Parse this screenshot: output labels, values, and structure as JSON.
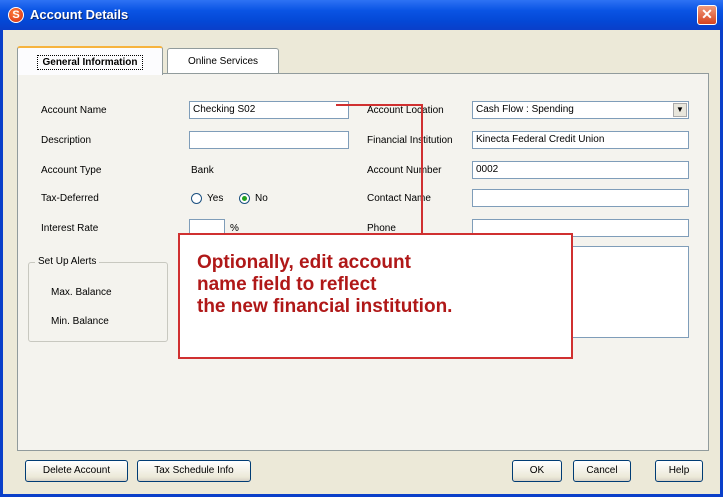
{
  "window": {
    "title": "Account Details",
    "close": "✕",
    "app_icon": "S"
  },
  "tabs": [
    {
      "label": "General Information",
      "active": true
    },
    {
      "label": "Online Services",
      "active": false
    }
  ],
  "form": {
    "account_name_label": "Account Name",
    "account_name_value": "Checking S02",
    "description_label": "Description",
    "description_value": "",
    "account_type_label": "Account Type",
    "account_type_value": "Bank",
    "tax_deferred_label": "Tax-Deferred",
    "tax_yes_label": "Yes",
    "tax_no_label": "No",
    "tax_selected": "No",
    "interest_rate_label": "Interest Rate",
    "interest_rate_unit": "%",
    "account_location_label": "Account Location",
    "account_location_value": "Cash Flow : Spending",
    "financial_institution_label": "Financial Institution",
    "financial_institution_value": "Kinecta Federal Credit  Union",
    "account_number_label": "Account Number",
    "account_number_value": "0002",
    "contact_name_label": "Contact Name",
    "phone_label": "Phone"
  },
  "alerts": {
    "title": "Set Up Alerts",
    "max_label": "Max. Balance",
    "min_label": "Min. Balance"
  },
  "callout": {
    "line1": "Optionally, edit account",
    "line2": "name field to reflect",
    "line3": "the new financial  institution."
  },
  "buttons": {
    "delete": "Delete Account",
    "tax_schedule": "Tax Schedule Info",
    "ok": "OK",
    "cancel": "Cancel",
    "help": "Help"
  },
  "colors": {
    "titlebar": "#0a54e4",
    "callout_border": "#d03030",
    "callout_text": "#b01818"
  }
}
